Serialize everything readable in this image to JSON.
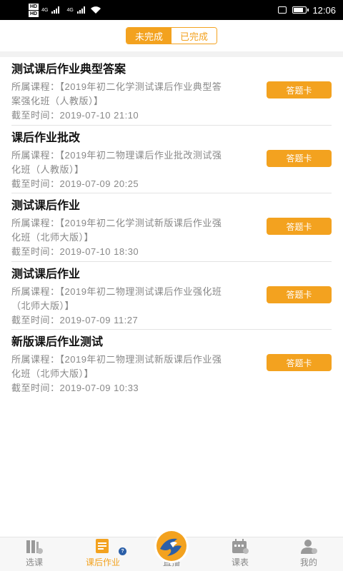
{
  "status_bar": {
    "sim1": "HD",
    "sim2": "HD",
    "net1": "4G",
    "net2": "4G",
    "time": "12:06",
    "battery_level": 0.8
  },
  "tabs": [
    {
      "label": "未完成",
      "active": true
    },
    {
      "label": "已完成",
      "active": false
    }
  ],
  "items": [
    {
      "title": "测试课后作业典型答案",
      "course_label": "所属课程：",
      "course": "【2019年初二化学测试课后作业典型答案强化班（人教版）】",
      "deadline_label": "截至时间：",
      "deadline": "2019-07-10 21:10",
      "button": "答题卡"
    },
    {
      "title": "课后作业批改",
      "course_label": "所属课程：",
      "course": "【2019年初二物理课后作业批改测试强化班（人教版）】",
      "deadline_label": "截至时间：",
      "deadline": "2019-07-09 20:25",
      "button": "答题卡"
    },
    {
      "title": "测试课后作业",
      "course_label": "所属课程：",
      "course": "【2019年初二化学测试新版课后作业强化班（北师大版）】",
      "deadline_label": "截至时间：",
      "deadline": "2019-07-10 18:30",
      "button": "答题卡"
    },
    {
      "title": "测试课后作业",
      "course_label": "所属课程：",
      "course": "【2019年初二物理测试课后作业强化班（北师大版）】",
      "deadline_label": "截至时间：",
      "deadline": "2019-07-09 11:27",
      "button": "答题卡"
    },
    {
      "title": "新版课后作业测试",
      "course_label": "所属课程：",
      "course": "【2019年初二物理测试新版课后作业强化班（北师大版）】",
      "deadline_label": "截至时间：",
      "deadline": "2019-07-09 10:33",
      "button": "答题卡"
    }
  ],
  "bottom_nav": [
    {
      "label": "选课",
      "icon": "books-icon",
      "active": false
    },
    {
      "label": "课后作业",
      "icon": "homework-icon",
      "active": true,
      "badge": "?"
    },
    {
      "label": "直播",
      "icon": "live-logo-icon",
      "active": false
    },
    {
      "label": "课表",
      "icon": "calendar-icon",
      "active": false
    },
    {
      "label": "我的",
      "icon": "profile-icon",
      "active": false
    }
  ],
  "colors": {
    "accent": "#f3a21f",
    "live_blue": "#2b5fa8"
  }
}
